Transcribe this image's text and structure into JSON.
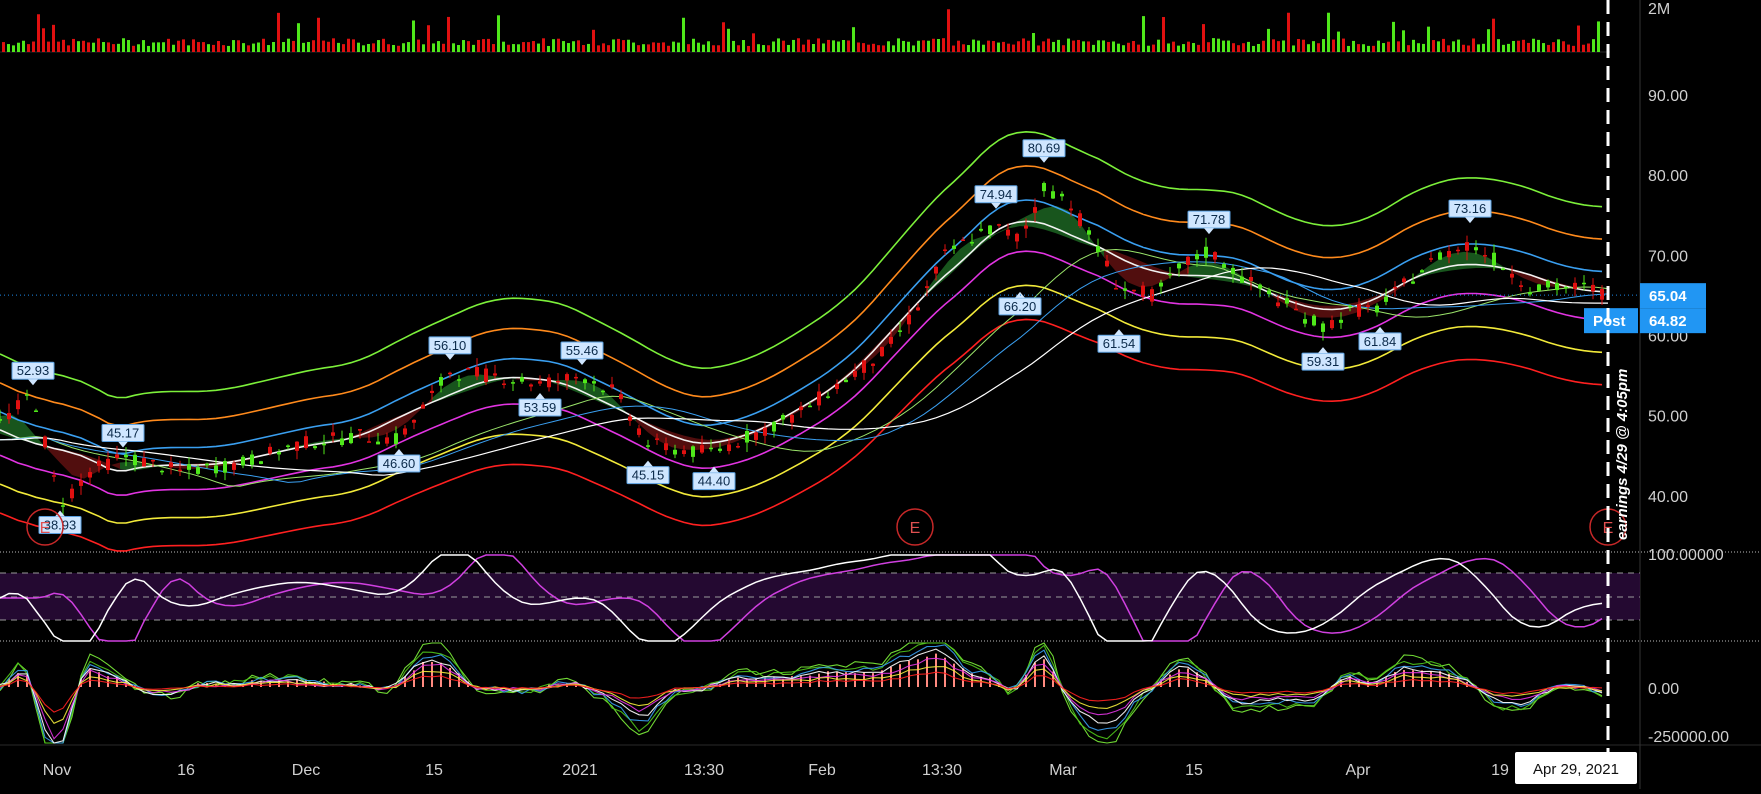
{
  "chart_data": {
    "type": "candlestick",
    "x_axis": {
      "tick_labels": [
        "Nov",
        "16",
        "Dec",
        "15",
        "2021",
        "13:30",
        "Feb",
        "13:30",
        "Mar",
        "15",
        "Apr",
        "19"
      ],
      "cursor_date": "Apr 29, 2021"
    },
    "price_axis": {
      "ticks": [
        "90.00",
        "80.00",
        "70.00",
        "60.00",
        "50.00",
        "40.00"
      ],
      "ylim": [
        33,
        95
      ]
    },
    "volume_axis": {
      "ticks": [
        "2M"
      ]
    },
    "oscillator_axis": {
      "ticks": [
        "100.00000"
      ]
    },
    "flow_axis": {
      "ticks": [
        "0.00",
        "-250000.00"
      ]
    },
    "last_price": "65.04",
    "post_label": "Post",
    "post_price": "64.82",
    "highlow_labels": [
      {
        "text": "52.93",
        "day": 11,
        "price": 52.93,
        "kind": "high"
      },
      {
        "text": "38.93",
        "day": 20,
        "price": 38.93,
        "kind": "low"
      },
      {
        "text": "45.17",
        "day": 41,
        "price": 45.17,
        "kind": "high"
      },
      {
        "text": "46.60",
        "day": 133,
        "price": 46.6,
        "kind": "low"
      },
      {
        "text": "56.10",
        "day": 150,
        "price": 56.1,
        "kind": "high"
      },
      {
        "text": "53.59",
        "day": 180,
        "price": 53.59,
        "kind": "low"
      },
      {
        "text": "55.46",
        "day": 194,
        "price": 55.46,
        "kind": "high"
      },
      {
        "text": "45.15",
        "day": 216,
        "price": 45.15,
        "kind": "low"
      },
      {
        "text": "44.40",
        "day": 238,
        "price": 44.4,
        "kind": "low"
      },
      {
        "text": "74.94",
        "day": 332,
        "price": 74.94,
        "kind": "high"
      },
      {
        "text": "80.69",
        "day": 348,
        "price": 80.69,
        "kind": "high"
      },
      {
        "text": "66.20",
        "day": 340,
        "price": 66.2,
        "kind": "low"
      },
      {
        "text": "61.54",
        "day": 373,
        "price": 61.54,
        "kind": "low"
      },
      {
        "text": "71.78",
        "day": 403,
        "price": 71.78,
        "kind": "high"
      },
      {
        "text": "59.31",
        "day": 441,
        "price": 59.31,
        "kind": "low"
      },
      {
        "text": "61.84",
        "day": 460,
        "price": 61.84,
        "kind": "low"
      },
      {
        "text": "73.16",
        "day": 490,
        "price": 73.16,
        "kind": "high"
      }
    ],
    "earnings_markers": [
      {
        "label": "E",
        "day": 15
      },
      {
        "label": "E",
        "day": 305
      },
      {
        "label": "E",
        "day": 536
      }
    ],
    "earnings_note": "earnings 4/29 @ 4:05pm",
    "price_path": [
      {
        "day": 0,
        "price": 49
      },
      {
        "day": 11,
        "price": 52.9
      },
      {
        "day": 20,
        "price": 39
      },
      {
        "day": 30,
        "price": 43
      },
      {
        "day": 41,
        "price": 45
      },
      {
        "day": 60,
        "price": 43
      },
      {
        "day": 80,
        "price": 44
      },
      {
        "day": 100,
        "price": 46.5
      },
      {
        "day": 120,
        "price": 47.5
      },
      {
        "day": 133,
        "price": 47
      },
      {
        "day": 150,
        "price": 55.5
      },
      {
        "day": 165,
        "price": 55
      },
      {
        "day": 180,
        "price": 54
      },
      {
        "day": 194,
        "price": 55
      },
      {
        "day": 205,
        "price": 53
      },
      {
        "day": 216,
        "price": 46.5
      },
      {
        "day": 230,
        "price": 45.5
      },
      {
        "day": 238,
        "price": 45.5
      },
      {
        "day": 250,
        "price": 47.5
      },
      {
        "day": 265,
        "price": 50
      },
      {
        "day": 280,
        "price": 54
      },
      {
        "day": 295,
        "price": 58
      },
      {
        "day": 305,
        "price": 63
      },
      {
        "day": 315,
        "price": 70
      },
      {
        "day": 325,
        "price": 72.5
      },
      {
        "day": 332,
        "price": 73.5
      },
      {
        "day": 340,
        "price": 72
      },
      {
        "day": 348,
        "price": 78.5
      },
      {
        "day": 356,
        "price": 77
      },
      {
        "day": 364,
        "price": 72
      },
      {
        "day": 373,
        "price": 66
      },
      {
        "day": 385,
        "price": 65
      },
      {
        "day": 395,
        "price": 69
      },
      {
        "day": 403,
        "price": 70.5
      },
      {
        "day": 415,
        "price": 67
      },
      {
        "day": 428,
        "price": 64
      },
      {
        "day": 441,
        "price": 61
      },
      {
        "day": 450,
        "price": 63
      },
      {
        "day": 460,
        "price": 63.5
      },
      {
        "day": 470,
        "price": 67
      },
      {
        "day": 480,
        "price": 70
      },
      {
        "day": 490,
        "price": 71.5
      },
      {
        "day": 500,
        "price": 69
      },
      {
        "day": 510,
        "price": 66
      },
      {
        "day": 520,
        "price": 66
      },
      {
        "day": 530,
        "price": 66
      },
      {
        "day": 536,
        "price": 65
      }
    ],
    "envelope_bands": [
      {
        "color": "#7cf03a",
        "offset": 10.5
      },
      {
        "color": "#ff8a1c",
        "offset": 6.5
      },
      {
        "color": "#3a9ff0",
        "offset": 2.5
      },
      {
        "color": "#f2f2f2",
        "offset": 0
      },
      {
        "color": "#e234e2",
        "offset": -3.5
      },
      {
        "color": "#f2ea3a",
        "offset": -7.5
      },
      {
        "color": "#ff2020",
        "offset": -11.5
      }
    ],
    "colors": {
      "up": "#4fe81a",
      "down": "#e01010",
      "price_line": "#1e88e5",
      "post_tag": "#2196f3",
      "cursor": "#ffffff",
      "earnings": "#c62828",
      "label_box": "#cfe6ff",
      "band_bull": "#1b5e20",
      "band_bear": "#5a1010",
      "osc_band": "#2a0a3a"
    }
  }
}
